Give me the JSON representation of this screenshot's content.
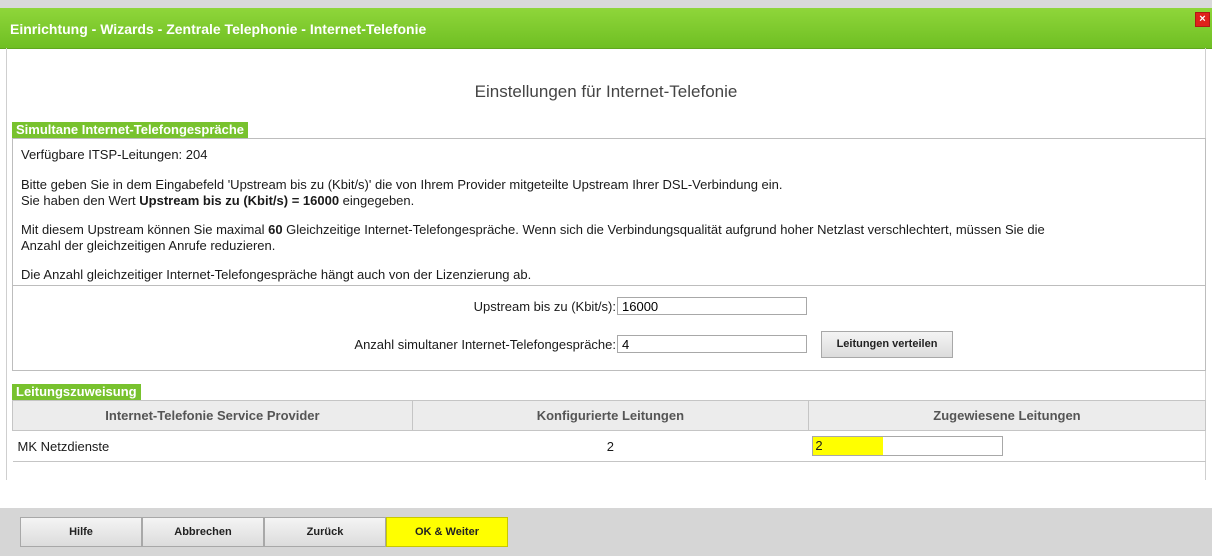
{
  "window": {
    "title": "Einrichtung - Wizards - Zentrale Telephonie - Internet-Telefonie",
    "close_glyph": "×"
  },
  "page": {
    "heading": "Einstellungen für Internet-Telefonie"
  },
  "simultaneous": {
    "section_label": "Simultane Internet-Telefongespräche",
    "available_lines": "Verfügbare ITSP-Leitungen: 204",
    "instr_line1": "Bitte geben Sie in dem Eingabefeld 'Upstream bis zu (Kbit/s)' die von Ihrem Provider mitgeteilte Upstream Ihrer DSL-Verbindung ein.",
    "instr_line2_pre": "Sie haben den Wert ",
    "instr_line2_bold": "Upstream bis zu (Kbit/s) = 16000",
    "instr_line2_post": " eingegeben.",
    "quality_pre": "Mit diesem Upstream können Sie maximal ",
    "quality_bold": "60",
    "quality_post": " Gleichzeitige Internet-Telefongespräche. Wenn sich die Verbindungsqualität aufgrund hoher Netzlast verschlechtert, müssen Sie die",
    "quality_line2": "Anzahl der gleichzeitigen Anrufe reduzieren.",
    "license_note": "Die Anzahl gleichzeitiger Internet-Telefongespräche hängt auch von der Lizenzierung ab.",
    "upstream_label": "Upstream bis zu (Kbit/s):",
    "upstream_value": "16000",
    "count_label": "Anzahl simultaner Internet-Telefongespräche:",
    "count_value": "4",
    "distribute_button": "Leitungen verteilen"
  },
  "assignment": {
    "section_label": "Leitungszuweisung",
    "columns": [
      "Internet-Telefonie Service Provider",
      "Konfigurierte Leitungen",
      "Zugewiesene Leitungen"
    ],
    "rows": [
      {
        "provider": "MK Netzdienste",
        "configured": "2",
        "assigned": "2"
      }
    ]
  },
  "footer": {
    "help": "Hilfe",
    "cancel": "Abbrechen",
    "back": "Zurück",
    "ok_next": "OK & Weiter"
  },
  "colors": {
    "title_green": "#78c22e",
    "highlight_yellow": "#ffff00",
    "close_red": "#e0221b"
  }
}
